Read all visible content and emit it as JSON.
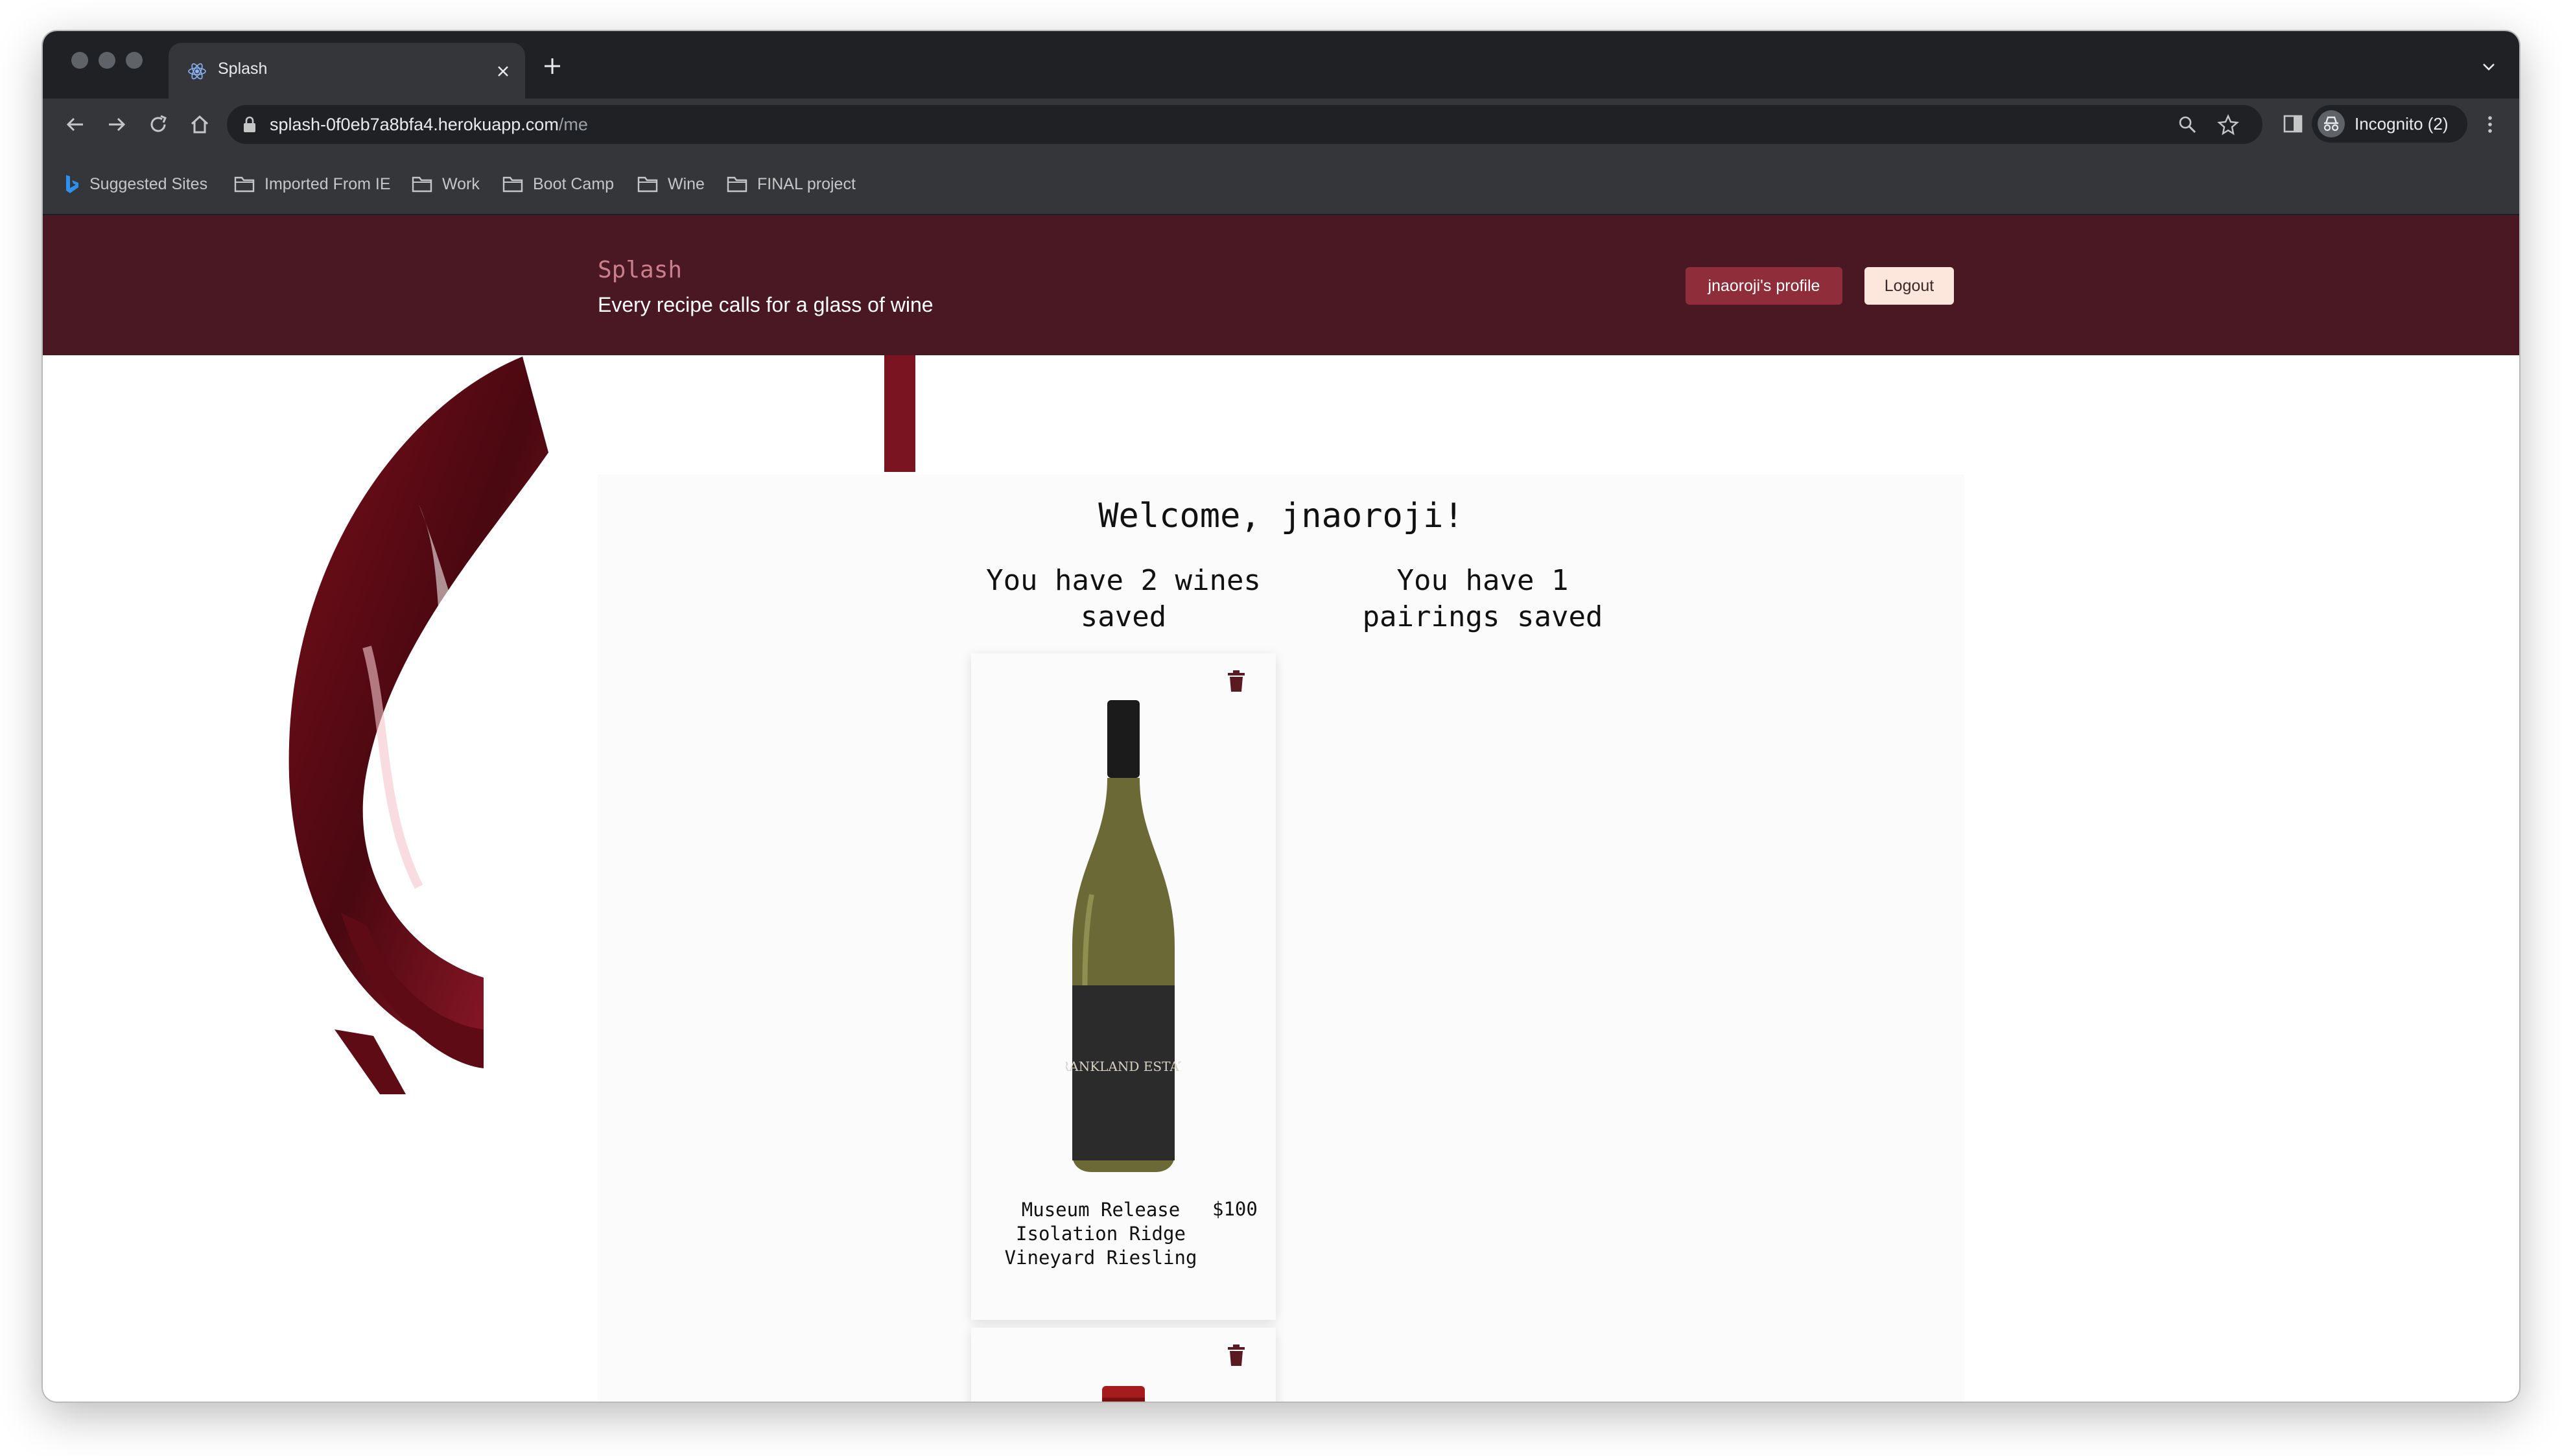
{
  "browser": {
    "tab_title": "Splash",
    "url_host": "splash-0f0eb7a8bfa4.herokuapp.com",
    "url_path": "/me",
    "profile_label": "Incognito (2)",
    "bookmarks": [
      "Suggested Sites",
      "Imported From IE",
      "Work",
      "Boot Camp",
      "Wine",
      "FINAL project"
    ]
  },
  "header": {
    "brand": "Splash",
    "tagline": "Every recipe calls for a glass of wine",
    "profile_button": "jnaoroji's profile",
    "logout_button": "Logout"
  },
  "main": {
    "welcome": "Welcome, jnaoroji!",
    "wines_saved": "You have 2 wines saved",
    "pairings_saved": "You have 1 pairings saved",
    "wines": [
      {
        "name": "Museum Release Isolation Ridge Vineyard Riesling",
        "price": "$100",
        "label_text": "FRANKLAND ESTATE"
      },
      {
        "name": "",
        "price": ""
      }
    ]
  },
  "colors": {
    "nav_bg": "#491822",
    "brand": "#c9808c",
    "profile_btn": "#8f2d3a",
    "logout_btn": "#fde7dc",
    "icon": "#5a1a22"
  }
}
